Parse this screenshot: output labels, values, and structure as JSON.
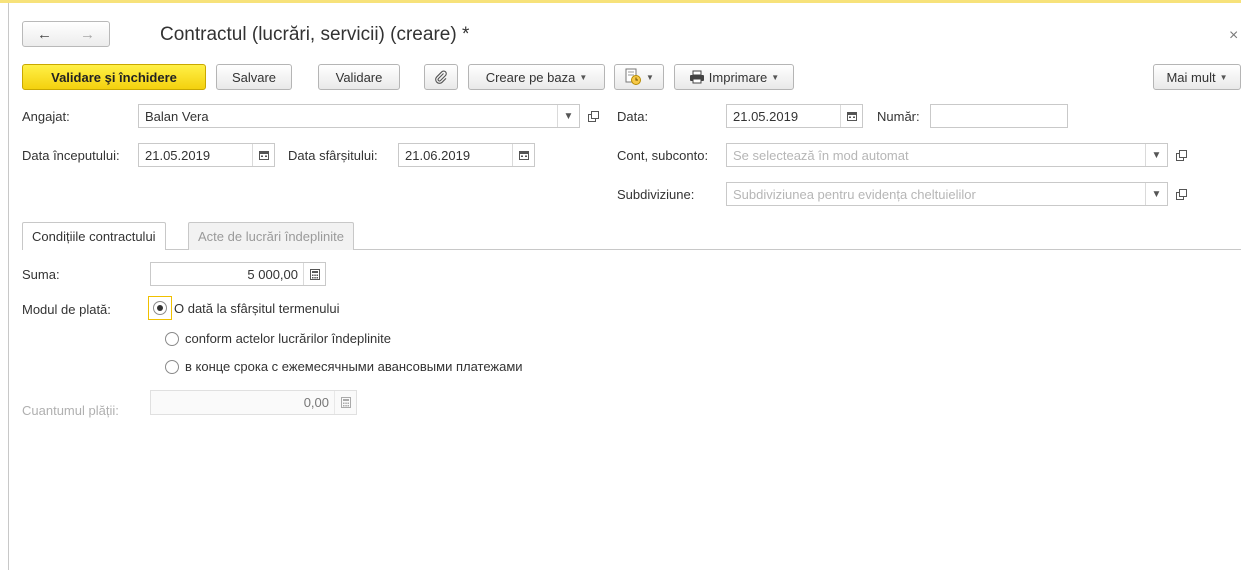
{
  "window": {
    "title": "Contractul (lucrări, servicii) (creare) *",
    "back_icon": "←",
    "forward_icon": "→",
    "close_icon": "×"
  },
  "toolbar": {
    "validate_close": "Validare şi închidere",
    "save": "Salvare",
    "validate": "Validare",
    "create_based": "Creare pe baza",
    "print": "Imprimare",
    "more": "Mai mult"
  },
  "form": {
    "employee_label": "Angajat:",
    "employee_value": "Balan Vera",
    "date_label": "Data:",
    "date_value": "21.05.2019",
    "number_label": "Număr:",
    "number_value": "",
    "start_label": "Data începutului:",
    "start_value": "21.05.2019",
    "end_label": "Data sfârșitului:",
    "end_value": "21.06.2019",
    "account_label": "Cont, subconto:",
    "account_placeholder": "Se selectează în mod automat",
    "subdivision_label": "Subdiviziune:",
    "subdivision_placeholder": "Subdiviziunea pentru evidența cheltuielilor"
  },
  "tabs": [
    {
      "label": "Condițiile contractului"
    },
    {
      "label": "Acte de lucrări îndeplinite"
    }
  ],
  "conditions": {
    "sum_label": "Suma:",
    "sum_value": "5 000,00",
    "payment_mode_label": "Modul de plată:",
    "payment_options": [
      "O dată la sfârșitul termenului",
      "conform actelor lucrărilor îndeplinite",
      "в конце срока с ежемесячными авансовыми платежами"
    ],
    "selected_option": 0,
    "payment_amount_label": "Cuantumul plății:",
    "payment_amount_value": "0,00"
  }
}
